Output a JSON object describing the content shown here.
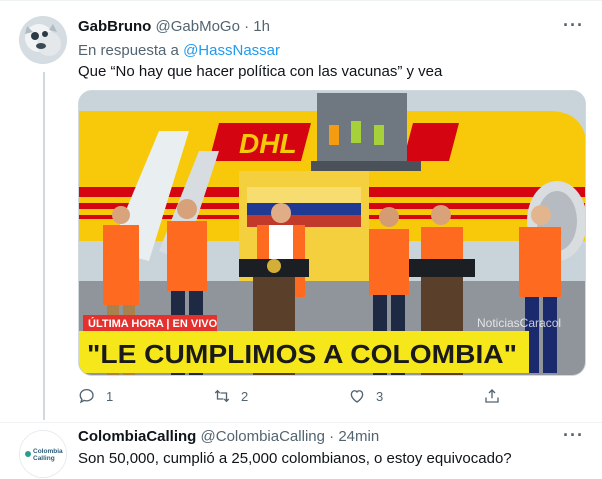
{
  "tweet1": {
    "display_name": "GabBruno",
    "handle": "@GabMoGo",
    "separator": "·",
    "time": "1h",
    "more": "···",
    "reply_prefix": "En respuesta a",
    "reply_mention": "@HassNassar",
    "text": "Que “No hay que hacer política con las vacunas” y vea",
    "media": {
      "banner_top": "ÚLTIMA HORA | EN VIVO",
      "headline": "\"LE CUMPLIMOS A COLOMBIA\"",
      "plane_brand": "DHL",
      "watermark": "NoticiasCaracol"
    },
    "actions": {
      "reply_icon": "reply-icon",
      "reply_count": "1",
      "retweet_icon": "retweet-icon",
      "retweet_count": "2",
      "like_icon": "heart-icon",
      "like_count": "3",
      "share_icon": "share-icon"
    }
  },
  "tweet2": {
    "display_name": "ColombiaCalling",
    "handle": "@ColombiaCalling",
    "separator": "·",
    "time": "24min",
    "more": "···",
    "avatar_text": "Colombia Calling",
    "text": "Son 50,000, cumplió a 25,000 colombianos, o estoy equivocado?"
  },
  "colors": {
    "text_primary": "#0f1419",
    "text_muted": "#536471",
    "link": "#1d9bf0",
    "dhl_yellow": "#f7c90a",
    "dhl_red": "#d40511",
    "banner_yellow": "#f6e71a"
  }
}
